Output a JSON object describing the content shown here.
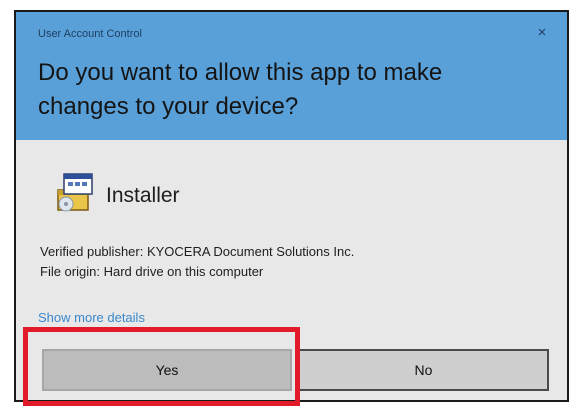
{
  "dialog": {
    "caption": "User Account Control",
    "close_label": "×",
    "question": "Do you want to allow this app to make changes to your device?",
    "app_name": "Installer",
    "publisher": "Verified publisher: KYOCERA Document Solutions Inc.",
    "origin": "File origin: Hard drive on this computer",
    "more_details": "Show more details",
    "yes_label": "Yes",
    "no_label": "No"
  },
  "colors": {
    "header": "#5aa0d8",
    "body": "#e8e8e8",
    "link": "#3a88cc",
    "highlight": "#e21b2a"
  },
  "icons": {
    "app": "installer-icon",
    "close": "close-icon"
  }
}
